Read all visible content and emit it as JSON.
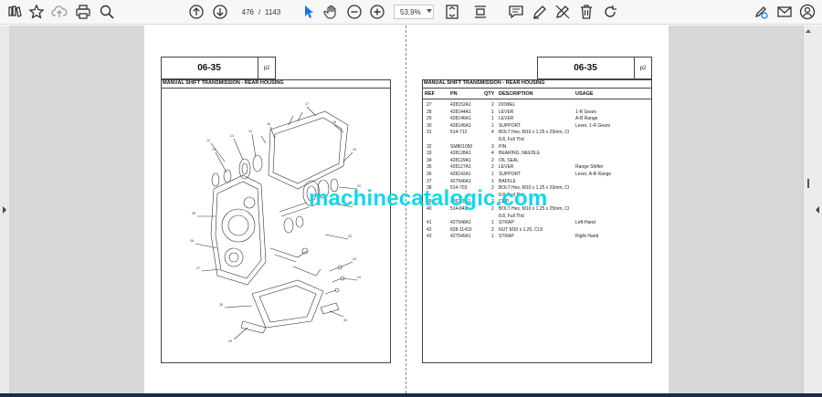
{
  "toolbar": {
    "current_page": "476",
    "separator": "/",
    "total_pages": "1143",
    "zoom": "53,9%"
  },
  "left_page": {
    "section_code": "06-35",
    "page_marker": "p2",
    "title": "MANUAL SHIFT TRANSMISSION - REAR HOUSING"
  },
  "right_page": {
    "section_code": "06-35",
    "page_marker": "p2",
    "title": "MANUAL SHIFT TRANSMISSION - REAR HOUSING",
    "columns": [
      "REF",
      "PN",
      "QTY",
      "DESCRIPTION",
      "USAGE"
    ],
    "rows": [
      {
        "ref": "27",
        "pn": "428152A1",
        "qty": "2",
        "desc": "DOWEL",
        "usage": ""
      },
      {
        "ref": "28",
        "pn": "428144A1",
        "qty": "1",
        "desc": "LEVER",
        "usage": "1-R Gears"
      },
      {
        "ref": "29",
        "pn": "428146A1",
        "qty": "1",
        "desc": "LEVER",
        "usage": "A-B Range"
      },
      {
        "ref": "30",
        "pn": "428145A1",
        "qty": "1",
        "desc": "SUPPORT",
        "usage": "Lever, 1-R Gears"
      },
      {
        "ref": "31",
        "pn": "514-712",
        "qty": "4",
        "desc": "BOLT Hex, M10 x 1.25 x 25mm, Cl",
        "desc2": "8.8, Full Thd",
        "usage": ""
      },
      {
        "ref": "32",
        "pn": "SM801050",
        "qty": "3",
        "desc": "PIN",
        "usage": ""
      },
      {
        "ref": "33",
        "pn": "428128A1",
        "qty": "4",
        "desc": "BEARING, NEEDLE",
        "usage": ""
      },
      {
        "ref": "34",
        "pn": "428129A1",
        "qty": "2",
        "desc": "OIL SEAL",
        "usage": ""
      },
      {
        "ref": "35",
        "pn": "428127A1",
        "qty": "2",
        "desc": "LEVER",
        "usage": "Range Shifter"
      },
      {
        "ref": "36",
        "pn": "428142A1",
        "qty": "1",
        "desc": "SUPPORT",
        "usage": "Lever, A-B Range"
      },
      {
        "ref": "37",
        "pn": "427546A1",
        "qty": "1",
        "desc": "BAFFLE",
        "usage": ""
      },
      {
        "ref": "38",
        "pn": "514-703",
        "qty": "2",
        "desc": "BOLT Hex, M10 x 1.25 x 20mm, Cl",
        "desc2": "8.8, Full Thd",
        "usage": ""
      },
      {
        "ref": "39",
        "pn": "426118A1",
        "qty": "2",
        "desc": "CLIP",
        "usage": ""
      },
      {
        "ref": "40",
        "pn": "514-842",
        "qty": "2",
        "desc": "BOLT Hex, M10 x 1.25 x 25mm, Cl",
        "desc2": "8.8, Full Thd",
        "usage": ""
      },
      {
        "ref": "41",
        "pn": "427548A1",
        "qty": "1",
        "desc": "STRAP",
        "usage": "Left-Hand"
      },
      {
        "ref": "42",
        "pn": "828-11410",
        "qty": "2",
        "desc": "NUT M10 x 1.25, Cl.8",
        "usage": ""
      },
      {
        "ref": "43",
        "pn": "427545A1",
        "qty": "1",
        "desc": "STRAP",
        "usage": "Right-Hand"
      }
    ]
  },
  "watermark": "machinecatalogic.com",
  "colors": {
    "watermark": "#11d8ea",
    "viewer_background": "#d7d7d7",
    "toolbar_background": "#f7f7f7"
  },
  "icons": {
    "toolbar_left": [
      "bookmark-icon",
      "star-icon",
      "upload-cloud-icon",
      "print-icon",
      "search-icon"
    ],
    "toolbar_middle": [
      "page-up-icon",
      "page-down-icon",
      "select-cursor-icon",
      "hand-tool-icon",
      "zoom-out-icon",
      "zoom-in-icon",
      "fit-page-icon",
      "scroll-mode-icon"
    ],
    "toolbar_right": [
      "comment-icon",
      "draw-pen-icon",
      "erase-pen-icon",
      "delete-icon",
      "rotate-icon",
      "edit-link-icon",
      "mail-icon",
      "account-icon"
    ]
  }
}
